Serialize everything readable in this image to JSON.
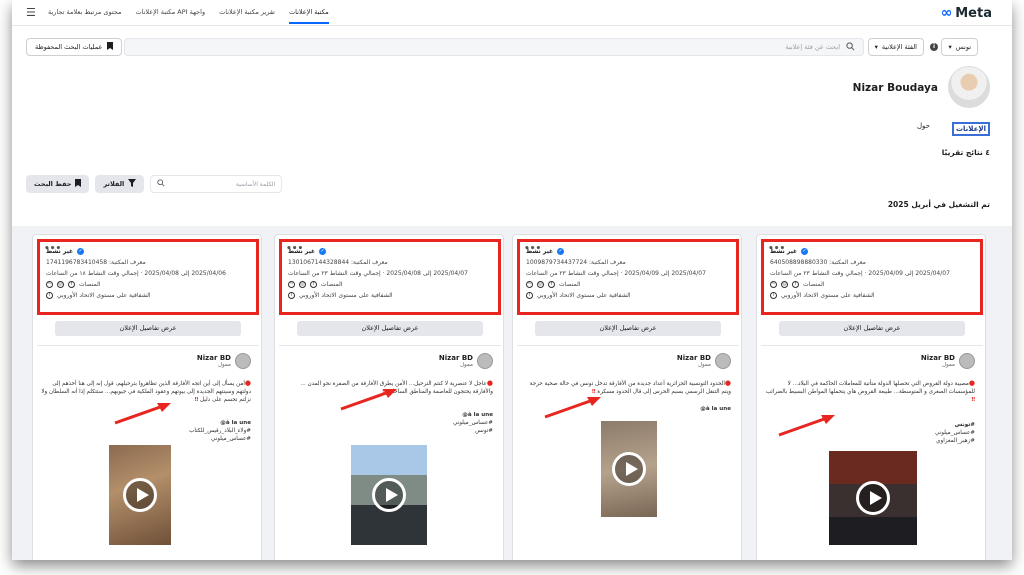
{
  "brand": {
    "name": "Meta",
    "accent": "#0866ff",
    "highlight": "#e8251f"
  },
  "nav": {
    "links": [
      "مكتبة الإعلانات",
      "تقرير مكتبة الإعلانات",
      "واجهة API مكتبة الإعلانات",
      "محتوى مرتبط بعلامة تجارية"
    ]
  },
  "search": {
    "country": "تونس",
    "category": "الفئة الإعلانية",
    "placeholder": "ابحث عن فئة إعلانية",
    "saved_searches": "عمليات البحث المحفوظة"
  },
  "profile": {
    "name": "Nizar Boudaya",
    "tabs": [
      "الإعلانات",
      "حول"
    ],
    "results": "٤ نتائج تقريبًا",
    "keyword_placeholder": "الكلمة الأساسية",
    "filters": "الفلاتر",
    "save_search": "حفظ البحث",
    "run_title": "تم التشغيل في أبريل 2025"
  },
  "cards": [
    {
      "status": "غير نشط",
      "library_id": "معرف المكتبة: 1741196783410458",
      "dates": "2025/04/06 إلى 2025/04/08 · إجمالي وقت النشاط ١٨ من الساعات",
      "platforms_label": "المنصات",
      "eu": "الشفافية على مستوى الاتحاد الأوروبي",
      "details": "عرض تفاصيل الإعلان",
      "advertiser": "Nizar BD",
      "sponsored": "ممول",
      "text": "أمن يسأل إلى أين اتجه الأفارقة الذين تظاهروا بترحيلهم، قول إنه إلى هنا أخذهم إلى دولتهم وسينتهم الجديدة إلى بيوتهم وعقود الملكية في جيوبهم... ستتكلم إذا أنه السلطان ولا نزلتم تحسم على دليل",
      "tags": [
        "à la une@",
        "#ولاء_البلاد_رقيس_للكتاب",
        "#عساس_ميلوني"
      ]
    },
    {
      "status": "غير نشط",
      "library_id": "معرف المكتبة: 1301067144328844",
      "dates": "2025/04/07 إلى 2025/04/08 · إجمالي وقت النشاط ٢٣ من الساعات",
      "platforms_label": "المنصات",
      "eu": "الشفافية على مستوى الاتحاد الأوروبي",
      "details": "عرض تفاصيل الإعلان",
      "advertiser": "Nizar BD",
      "sponsored": "ممول",
      "text": "عاجل لا عنصرية لا كنتم الترحيل... الأمن يطرق الأفارقة من الصفرة نحو المدن ... والأفارقة يحتجون للعاصمة والمناطق الساحلية",
      "tags": [
        "à la une@",
        "#عساس_ميلوني",
        "#تونس"
      ]
    },
    {
      "status": "غير نشط",
      "library_id": "معرف المكتبة: 1009879734437724",
      "dates": "2025/04/07 إلى 2025/04/09 · إجمالي وقت النشاط ٢٣ من الساعات",
      "platforms_label": "المنصات",
      "eu": "الشفافية على مستوى الاتحاد الأوروبي",
      "details": "عرض تفاصيل الإعلان",
      "advertiser": "Nizar BD",
      "sponsored": "ممول",
      "text": "الحدود التونسية الجزائرية أعداد جديدة من الأفارقة تدخل تونس في حالة صحية حرجة ويتم التنقل الرسمي بسبم الحرس إلى قال الحدود مسكرة",
      "tags": [
        "à la une@"
      ]
    },
    {
      "status": "غير نشط",
      "library_id": "معرف المكتبة: 640508898880330",
      "dates": "2025/04/07 إلى 2025/04/09 · إجمالي وقت النشاط ٢٣ من الساعات",
      "platforms_label": "المنصات",
      "eu": "الشفافية على مستوى الاتحاد الأوروبي",
      "details": "عرض تفاصيل الإعلان",
      "advertiser": "Nizar BD",
      "sponsored": "ممول",
      "text": "مصيبة دولة القروض التي تحصلها الدولة متأتية للمعاملات الحاكمة في البلاد... لا للمؤسسات الصغرى و المتوسطة... طبيعة القروض هاي يتحملها المواطن البسيط بالضرائب",
      "tags": [
        "#تونس",
        "#عساس_ميلوني",
        "#زهير_المغزاوي"
      ]
    }
  ]
}
